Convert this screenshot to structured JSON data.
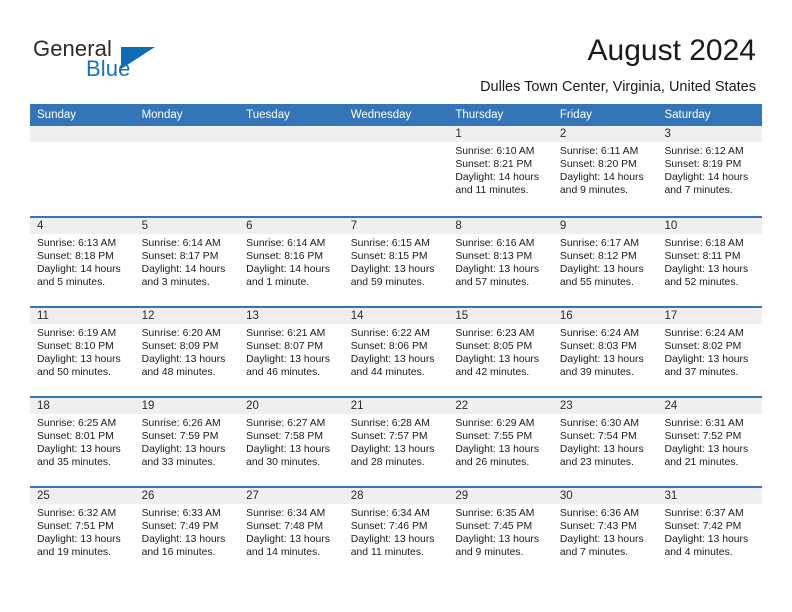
{
  "brand": {
    "name_part1": "General",
    "name_part2": "Blue"
  },
  "header": {
    "month_title": "August 2024",
    "location": "Dulles Town Center, Virginia, United States"
  },
  "calendar": {
    "weekdays": [
      "Sunday",
      "Monday",
      "Tuesday",
      "Wednesday",
      "Thursday",
      "Friday",
      "Saturday"
    ],
    "accent_color": "#3375b6",
    "day_band_color": "#efefef",
    "weeks": [
      [
        {
          "day": "",
          "sunrise": "",
          "sunset": "",
          "daylight": "",
          "empty": true
        },
        {
          "day": "",
          "sunrise": "",
          "sunset": "",
          "daylight": "",
          "empty": true
        },
        {
          "day": "",
          "sunrise": "",
          "sunset": "",
          "daylight": "",
          "empty": true
        },
        {
          "day": "",
          "sunrise": "",
          "sunset": "",
          "daylight": "",
          "empty": true
        },
        {
          "day": "1",
          "sunrise": "Sunrise: 6:10 AM",
          "sunset": "Sunset: 8:21 PM",
          "daylight": "Daylight: 14 hours and 11 minutes."
        },
        {
          "day": "2",
          "sunrise": "Sunrise: 6:11 AM",
          "sunset": "Sunset: 8:20 PM",
          "daylight": "Daylight: 14 hours and 9 minutes."
        },
        {
          "day": "3",
          "sunrise": "Sunrise: 6:12 AM",
          "sunset": "Sunset: 8:19 PM",
          "daylight": "Daylight: 14 hours and 7 minutes."
        }
      ],
      [
        {
          "day": "4",
          "sunrise": "Sunrise: 6:13 AM",
          "sunset": "Sunset: 8:18 PM",
          "daylight": "Daylight: 14 hours and 5 minutes."
        },
        {
          "day": "5",
          "sunrise": "Sunrise: 6:14 AM",
          "sunset": "Sunset: 8:17 PM",
          "daylight": "Daylight: 14 hours and 3 minutes."
        },
        {
          "day": "6",
          "sunrise": "Sunrise: 6:14 AM",
          "sunset": "Sunset: 8:16 PM",
          "daylight": "Daylight: 14 hours and 1 minute."
        },
        {
          "day": "7",
          "sunrise": "Sunrise: 6:15 AM",
          "sunset": "Sunset: 8:15 PM",
          "daylight": "Daylight: 13 hours and 59 minutes."
        },
        {
          "day": "8",
          "sunrise": "Sunrise: 6:16 AM",
          "sunset": "Sunset: 8:13 PM",
          "daylight": "Daylight: 13 hours and 57 minutes."
        },
        {
          "day": "9",
          "sunrise": "Sunrise: 6:17 AM",
          "sunset": "Sunset: 8:12 PM",
          "daylight": "Daylight: 13 hours and 55 minutes."
        },
        {
          "day": "10",
          "sunrise": "Sunrise: 6:18 AM",
          "sunset": "Sunset: 8:11 PM",
          "daylight": "Daylight: 13 hours and 52 minutes."
        }
      ],
      [
        {
          "day": "11",
          "sunrise": "Sunrise: 6:19 AM",
          "sunset": "Sunset: 8:10 PM",
          "daylight": "Daylight: 13 hours and 50 minutes."
        },
        {
          "day": "12",
          "sunrise": "Sunrise: 6:20 AM",
          "sunset": "Sunset: 8:09 PM",
          "daylight": "Daylight: 13 hours and 48 minutes."
        },
        {
          "day": "13",
          "sunrise": "Sunrise: 6:21 AM",
          "sunset": "Sunset: 8:07 PM",
          "daylight": "Daylight: 13 hours and 46 minutes."
        },
        {
          "day": "14",
          "sunrise": "Sunrise: 6:22 AM",
          "sunset": "Sunset: 8:06 PM",
          "daylight": "Daylight: 13 hours and 44 minutes."
        },
        {
          "day": "15",
          "sunrise": "Sunrise: 6:23 AM",
          "sunset": "Sunset: 8:05 PM",
          "daylight": "Daylight: 13 hours and 42 minutes."
        },
        {
          "day": "16",
          "sunrise": "Sunrise: 6:24 AM",
          "sunset": "Sunset: 8:03 PM",
          "daylight": "Daylight: 13 hours and 39 minutes."
        },
        {
          "day": "17",
          "sunrise": "Sunrise: 6:24 AM",
          "sunset": "Sunset: 8:02 PM",
          "daylight": "Daylight: 13 hours and 37 minutes."
        }
      ],
      [
        {
          "day": "18",
          "sunrise": "Sunrise: 6:25 AM",
          "sunset": "Sunset: 8:01 PM",
          "daylight": "Daylight: 13 hours and 35 minutes."
        },
        {
          "day": "19",
          "sunrise": "Sunrise: 6:26 AM",
          "sunset": "Sunset: 7:59 PM",
          "daylight": "Daylight: 13 hours and 33 minutes."
        },
        {
          "day": "20",
          "sunrise": "Sunrise: 6:27 AM",
          "sunset": "Sunset: 7:58 PM",
          "daylight": "Daylight: 13 hours and 30 minutes."
        },
        {
          "day": "21",
          "sunrise": "Sunrise: 6:28 AM",
          "sunset": "Sunset: 7:57 PM",
          "daylight": "Daylight: 13 hours and 28 minutes."
        },
        {
          "day": "22",
          "sunrise": "Sunrise: 6:29 AM",
          "sunset": "Sunset: 7:55 PM",
          "daylight": "Daylight: 13 hours and 26 minutes."
        },
        {
          "day": "23",
          "sunrise": "Sunrise: 6:30 AM",
          "sunset": "Sunset: 7:54 PM",
          "daylight": "Daylight: 13 hours and 23 minutes."
        },
        {
          "day": "24",
          "sunrise": "Sunrise: 6:31 AM",
          "sunset": "Sunset: 7:52 PM",
          "daylight": "Daylight: 13 hours and 21 minutes."
        }
      ],
      [
        {
          "day": "25",
          "sunrise": "Sunrise: 6:32 AM",
          "sunset": "Sunset: 7:51 PM",
          "daylight": "Daylight: 13 hours and 19 minutes."
        },
        {
          "day": "26",
          "sunrise": "Sunrise: 6:33 AM",
          "sunset": "Sunset: 7:49 PM",
          "daylight": "Daylight: 13 hours and 16 minutes."
        },
        {
          "day": "27",
          "sunrise": "Sunrise: 6:34 AM",
          "sunset": "Sunset: 7:48 PM",
          "daylight": "Daylight: 13 hours and 14 minutes."
        },
        {
          "day": "28",
          "sunrise": "Sunrise: 6:34 AM",
          "sunset": "Sunset: 7:46 PM",
          "daylight": "Daylight: 13 hours and 11 minutes."
        },
        {
          "day": "29",
          "sunrise": "Sunrise: 6:35 AM",
          "sunset": "Sunset: 7:45 PM",
          "daylight": "Daylight: 13 hours and 9 minutes."
        },
        {
          "day": "30",
          "sunrise": "Sunrise: 6:36 AM",
          "sunset": "Sunset: 7:43 PM",
          "daylight": "Daylight: 13 hours and 7 minutes."
        },
        {
          "day": "31",
          "sunrise": "Sunrise: 6:37 AM",
          "sunset": "Sunset: 7:42 PM",
          "daylight": "Daylight: 13 hours and 4 minutes."
        }
      ]
    ]
  }
}
